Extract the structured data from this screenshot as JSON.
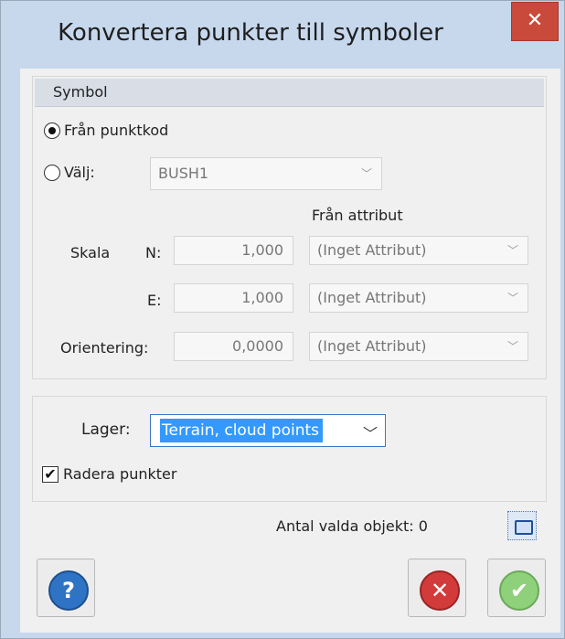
{
  "window": {
    "title": "Konvertera punkter till symboler"
  },
  "symbol_group": {
    "header": "Symbol",
    "option_from_code": "Från punktkod",
    "option_choose": "Välj:",
    "choose_value": "BUSH1",
    "from_attribute_header": "Från attribut",
    "scale_label": "Skala",
    "n_label": "N:",
    "n_value": "1,000",
    "n_attribute": "(Inget Attribut)",
    "e_label": "E:",
    "e_value": "1,000",
    "e_attribute": "(Inget Attribut)",
    "orientation_label": "Orientering:",
    "orientation_value": "0,0000",
    "orientation_attribute": "(Inget Attribut)",
    "selected_option": "from_code"
  },
  "layer_group": {
    "label": "Lager:",
    "value": "Terrain, cloud points",
    "delete_points_label": "Radera punkter",
    "delete_points_checked": true
  },
  "footer": {
    "selected_count_label": "Antal valda objekt: 0"
  },
  "icons": {
    "help": "question-icon",
    "cancel": "x-icon",
    "ok": "check-icon",
    "close": "close-icon",
    "select": "select-objects-icon"
  },
  "colors": {
    "titlebar": "#c7d8ed",
    "close": "#c94a3a",
    "selection": "#3399ff",
    "help": "#2f73c4",
    "cancel": "#d33b3b",
    "ok": "#8fd07a"
  }
}
